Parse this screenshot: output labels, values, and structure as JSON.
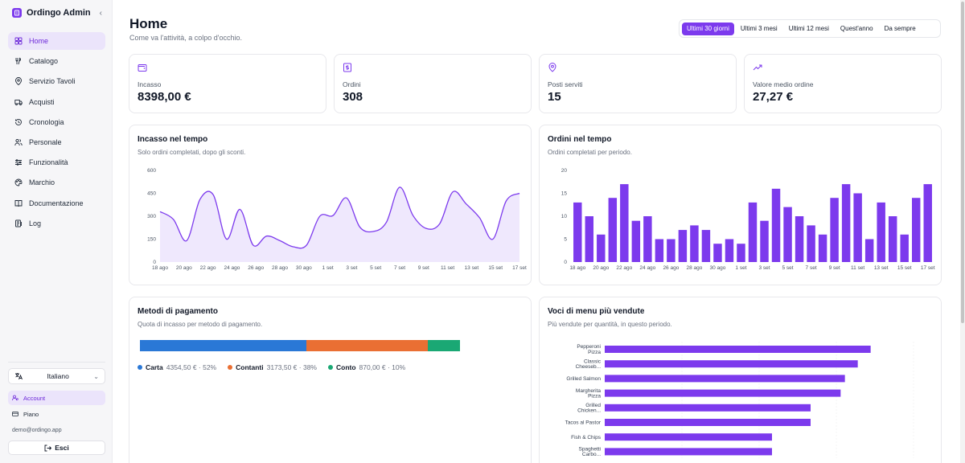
{
  "app": {
    "brand": "Ordingo Admin"
  },
  "sidebar": {
    "items": [
      {
        "label": "Home",
        "icon": "grid-icon",
        "active": true
      },
      {
        "label": "Catalogo",
        "icon": "utensils-icon",
        "active": false
      },
      {
        "label": "Servizio Tavoli",
        "icon": "map-pin-icon",
        "active": false
      },
      {
        "label": "Acquisti",
        "icon": "truck-icon",
        "active": false
      },
      {
        "label": "Cronologia",
        "icon": "history-icon",
        "active": false
      },
      {
        "label": "Personale",
        "icon": "users-icon",
        "active": false
      },
      {
        "label": "Funzionalità",
        "icon": "sliders-icon",
        "active": false
      },
      {
        "label": "Marchio",
        "icon": "palette-icon",
        "active": false
      },
      {
        "label": "Documentazione",
        "icon": "book-icon",
        "active": false
      },
      {
        "label": "Log",
        "icon": "log-icon",
        "active": false
      }
    ],
    "language": "Italiano",
    "account_label": "Account",
    "plan_label": "Piano",
    "email": "demo@ordingo.app",
    "logout_label": "Esci"
  },
  "header": {
    "title": "Home",
    "subtitle": "Come va l'attività, a colpo d'occhio.",
    "ranges": [
      "Ultimi 30 giorni",
      "Ultimi 3 mesi",
      "Ultimi 12 mesi",
      "Quest'anno",
      "Da sempre"
    ],
    "active_range": 0
  },
  "stats": [
    {
      "label": "Incasso",
      "value": "8398,00 €",
      "icon": "wallet-icon"
    },
    {
      "label": "Ordini",
      "value": "308",
      "icon": "receipt-icon"
    },
    {
      "label": "Posti serviti",
      "value": "15",
      "icon": "map-pin-icon"
    },
    {
      "label": "Valore medio ordine",
      "value": "27,27 €",
      "icon": "trending-up-icon"
    }
  ],
  "revenue_card": {
    "title": "Incasso nel tempo",
    "subtitle": "Solo ordini completati, dopo gli sconti."
  },
  "orders_card": {
    "title": "Ordini nel tempo",
    "subtitle": "Ordini completati per periodo."
  },
  "payments_card": {
    "title": "Metodi di pagamento",
    "subtitle": "Quota di incasso per metodo di pagamento.",
    "methods": [
      {
        "name": "Carta",
        "value": "4354,50 € · 52%",
        "share": 0.52,
        "color": "#2a78d6"
      },
      {
        "name": "Contanti",
        "value": "3173,50 € · 38%",
        "share": 0.38,
        "color": "#ea6f33"
      },
      {
        "name": "Conto",
        "value": "870,00 € · 10%",
        "share": 0.1,
        "color": "#1aa874"
      }
    ]
  },
  "top_items_card": {
    "title": "Voci di menu più vendute",
    "subtitle": "Più vendute per quantità, in questo periodo."
  },
  "colors": {
    "accent": "#7c3aed",
    "line_fill": "#efe8fd"
  },
  "chart_data": [
    {
      "type": "area",
      "yticks": [
        0,
        150,
        300,
        450,
        600
      ],
      "ylim": [
        0,
        600
      ],
      "xticks": [
        "18 ago",
        "20 ago",
        "22 ago",
        "24 ago",
        "26 ago",
        "28 ago",
        "30 ago",
        "1 set",
        "3 set",
        "5 set",
        "7 set",
        "9 set",
        "11 set",
        "13 set",
        "15 set",
        "17 set"
      ],
      "values": [
        330,
        280,
        140,
        410,
        440,
        150,
        345,
        110,
        170,
        140,
        100,
        110,
        300,
        305,
        420,
        230,
        200,
        260,
        490,
        305,
        220,
        250,
        460,
        380,
        290,
        150,
        400,
        450
      ],
      "grid": false
    },
    {
      "type": "bar",
      "yticks": [
        0,
        5,
        10,
        15,
        20
      ],
      "ylim": [
        0,
        20
      ],
      "xticks": [
        "18 ago",
        "20 ago",
        "22 ago",
        "24 ago",
        "26 ago",
        "28 ago",
        "30 ago",
        "1 set",
        "3 set",
        "5 set",
        "7 set",
        "9 set",
        "11 set",
        "13 set",
        "15 set",
        "17 set"
      ],
      "values": [
        13,
        10,
        6,
        14,
        17,
        9,
        10,
        5,
        5,
        7,
        8,
        7,
        4,
        5,
        4,
        13,
        9,
        16,
        12,
        10,
        8,
        6,
        14,
        17,
        15,
        5,
        13,
        10,
        6,
        14,
        17
      ],
      "grid": false
    },
    {
      "type": "bar",
      "orientation": "horizontal",
      "categories": [
        [
          "Pepperoni",
          "Pizza"
        ],
        [
          "Classic",
          "Cheeseb..."
        ],
        [
          "Grilled Salmon"
        ],
        [
          "Margherita",
          "Pizza"
        ],
        [
          "Grilled",
          "Chicken..."
        ],
        [
          "Tacos al Pastor"
        ],
        [
          "Fish & Chips"
        ],
        [
          "Spaghetti",
          "Carbo..."
        ]
      ],
      "values": [
        31,
        29.5,
        28,
        27.5,
        24,
        24,
        19.5,
        19.5
      ],
      "xlim": [
        0,
        36
      ]
    }
  ]
}
